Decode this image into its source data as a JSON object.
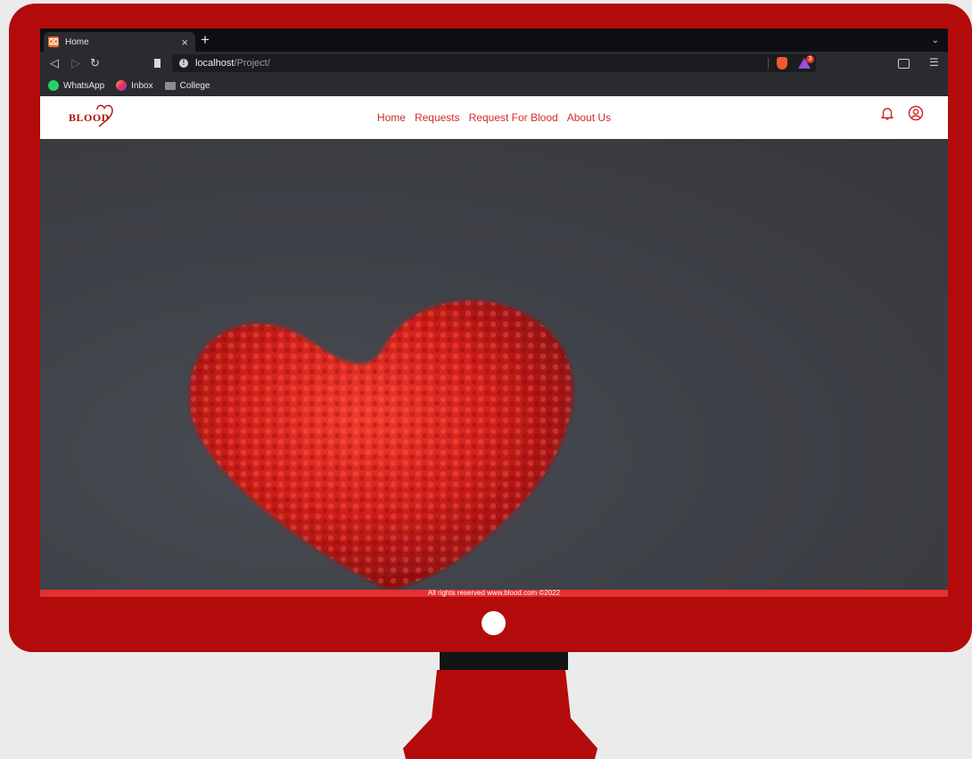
{
  "tab": {
    "favicon": "⌧",
    "title": "Home"
  },
  "browser": {
    "url_host": "localhost",
    "url_path": "/Project/",
    "shield_icon": "brave-shield-icon",
    "rewards_badge": "3"
  },
  "bookmarks": [
    {
      "label": "WhatsApp",
      "icon": "whatsapp-icon",
      "color": "#25d366"
    },
    {
      "label": "Inbox",
      "icon": "instagram-icon",
      "color": "#e1306c"
    },
    {
      "label": "College",
      "icon": "folder-icon",
      "color": "#8d8d8d"
    }
  ],
  "site": {
    "logo_text": "BLOOD",
    "nav": [
      "Home",
      "Requests",
      "Request For Blood",
      "About Us"
    ],
    "footer": "All rights reserved www.blood.com ©2022"
  },
  "colors": {
    "monitor": "#b30b0b",
    "accent": "#d32a2a",
    "footer_bar": "#e53131"
  }
}
